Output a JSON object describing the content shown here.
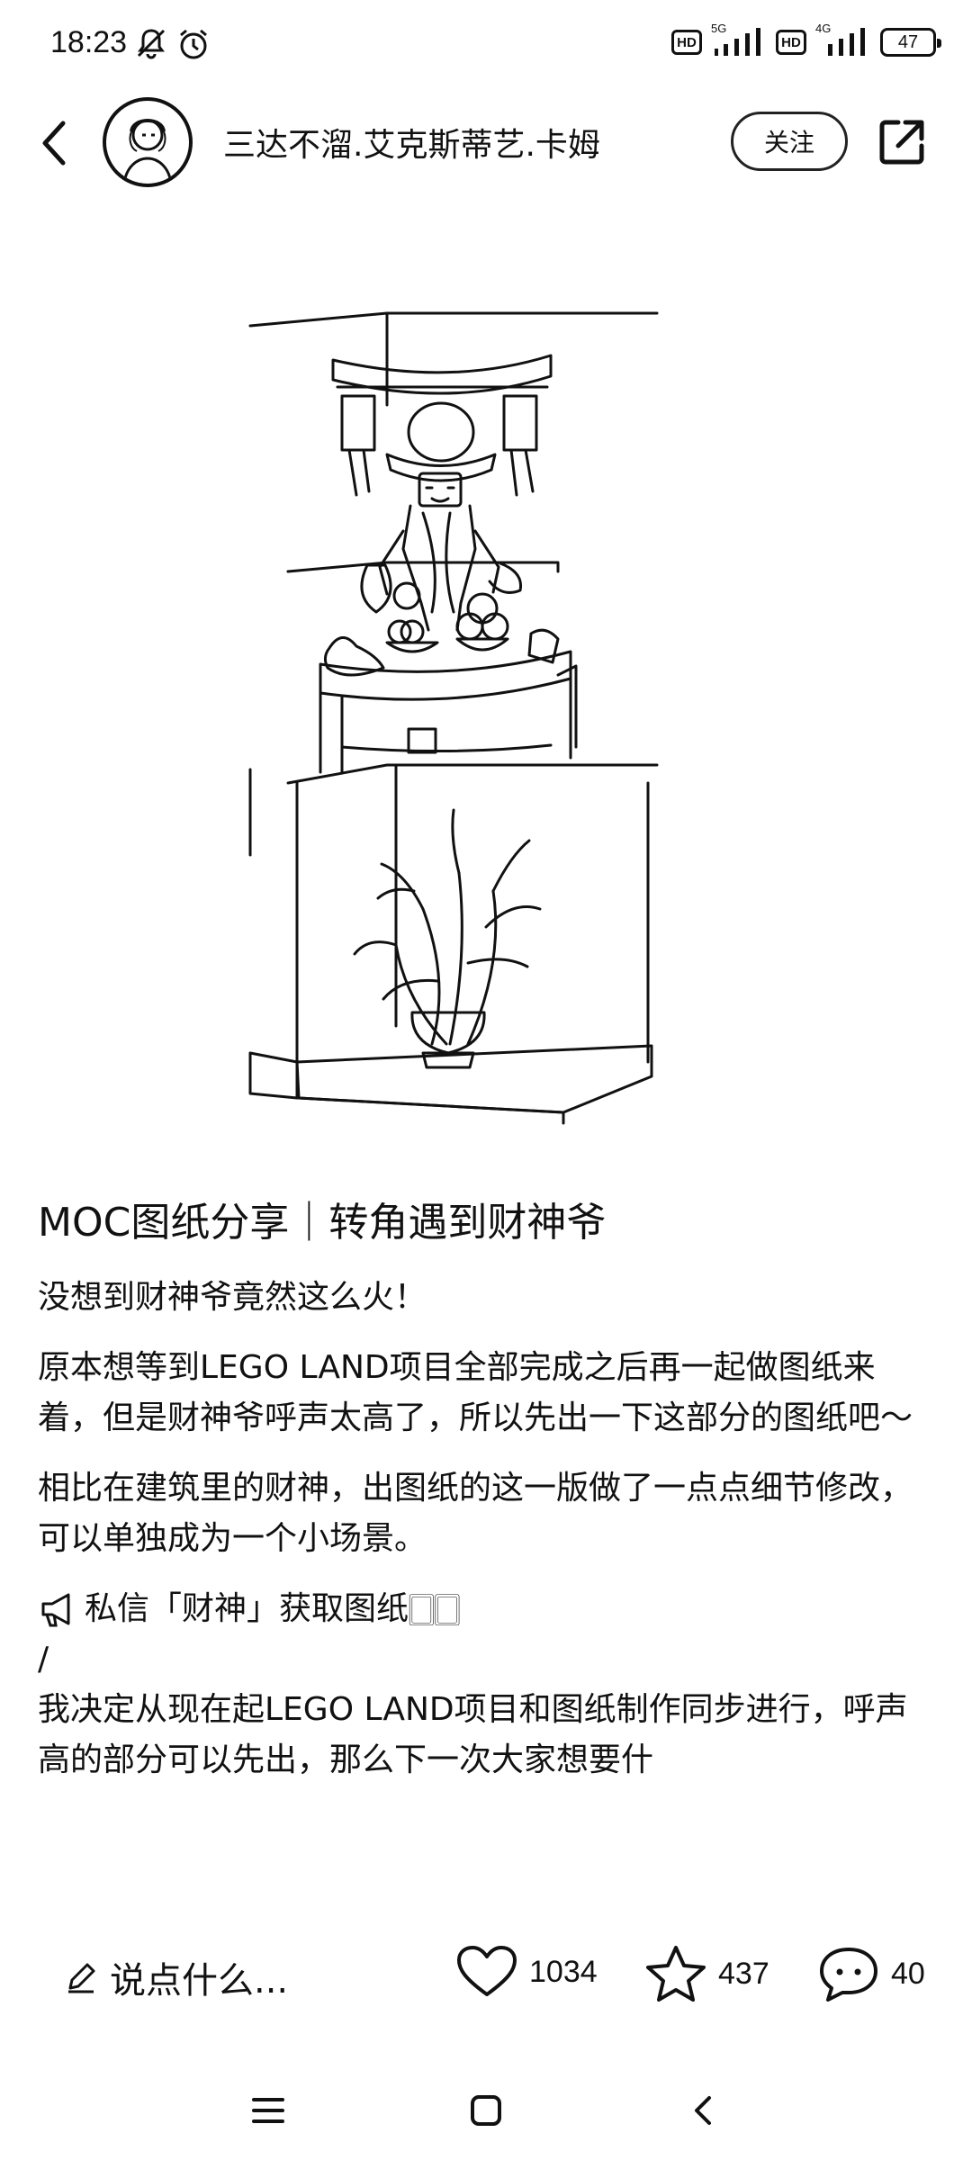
{
  "status_bar": {
    "time": "18:23",
    "hd1": "HD",
    "net1": "5G",
    "hd2": "HD",
    "net2": "4G",
    "battery": "47"
  },
  "header": {
    "author_name": "三达不溜.艾克斯蒂艺.卡姆",
    "follow_label": "关注"
  },
  "post": {
    "title": "MOC图纸分享｜转角遇到财神爷",
    "p1": "没想到财神爷竟然这么火！",
    "p2": "原本想等到LEGO LAND项目全部完成之后再一起做图纸来着，但是财神爷呼声太高了，所以先出一下这部分的图纸吧～",
    "p3": "相比在建筑里的财神，出图纸的这一版做了一点点细节修改，可以单独成为一个小场景。",
    "p4": "私信「财神」获取图纸🀆🀆",
    "p5": "/",
    "p6": "我决定从现在起LEGO LAND项目和图纸制作同步进行，呼声高的部分可以先出，那么下一次大家想要什"
  },
  "bottom_bar": {
    "comment_placeholder": "说点什么...",
    "likes": "1034",
    "favorites": "437",
    "comments": "40"
  },
  "icons": {
    "back": "back-chevron-icon",
    "share": "share-icon",
    "pencil": "pencil-icon",
    "heart": "heart-icon",
    "star": "star-icon",
    "comment": "comment-bubble-icon",
    "megaphone": "megaphone-icon"
  }
}
